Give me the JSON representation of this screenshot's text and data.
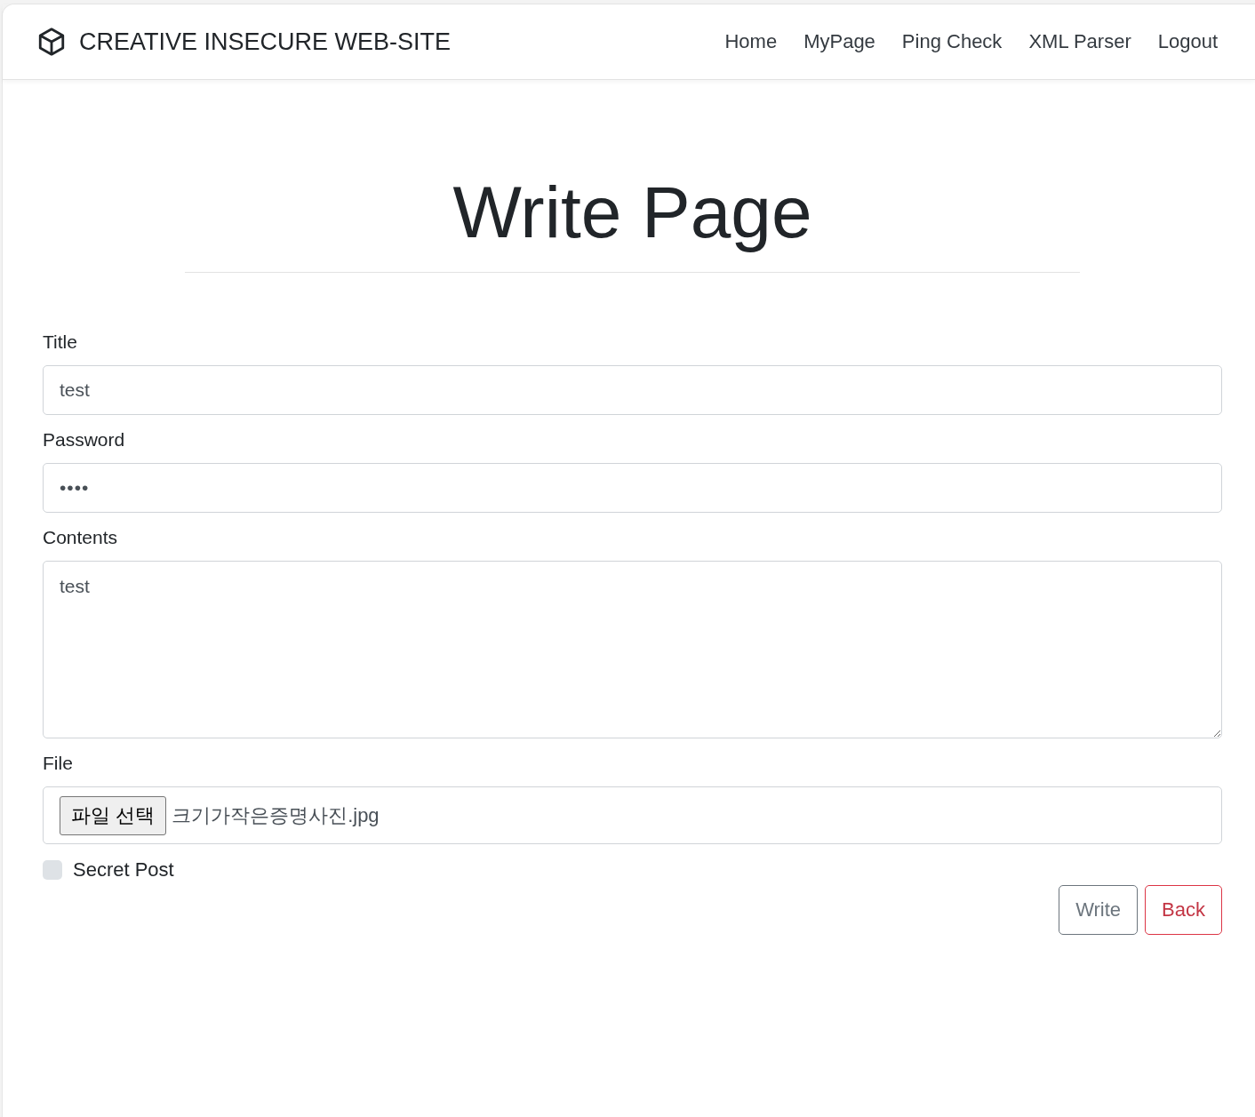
{
  "navbar": {
    "brand": "CREATIVE INSECURE WEB-SITE",
    "links": [
      {
        "label": "Home"
      },
      {
        "label": "MyPage"
      },
      {
        "label": "Ping Check"
      },
      {
        "label": "XML Parser"
      },
      {
        "label": "Logout"
      }
    ]
  },
  "heading": "Write Page",
  "form": {
    "fields": [
      {
        "kind": "text",
        "label": "Title",
        "value": "test"
      },
      {
        "kind": "password",
        "label": "Password",
        "value": "••••"
      },
      {
        "kind": "textarea",
        "label": "Contents",
        "value": "test"
      },
      {
        "kind": "file",
        "label": "File",
        "button": "파일 선택",
        "value": "크기가작은증명사진.jpg"
      }
    ],
    "checkbox": {
      "label": "Secret Post",
      "checked": false
    },
    "buttons": [
      {
        "label": "Write",
        "kind": "secondary"
      },
      {
        "label": "Back",
        "kind": "danger"
      }
    ]
  }
}
